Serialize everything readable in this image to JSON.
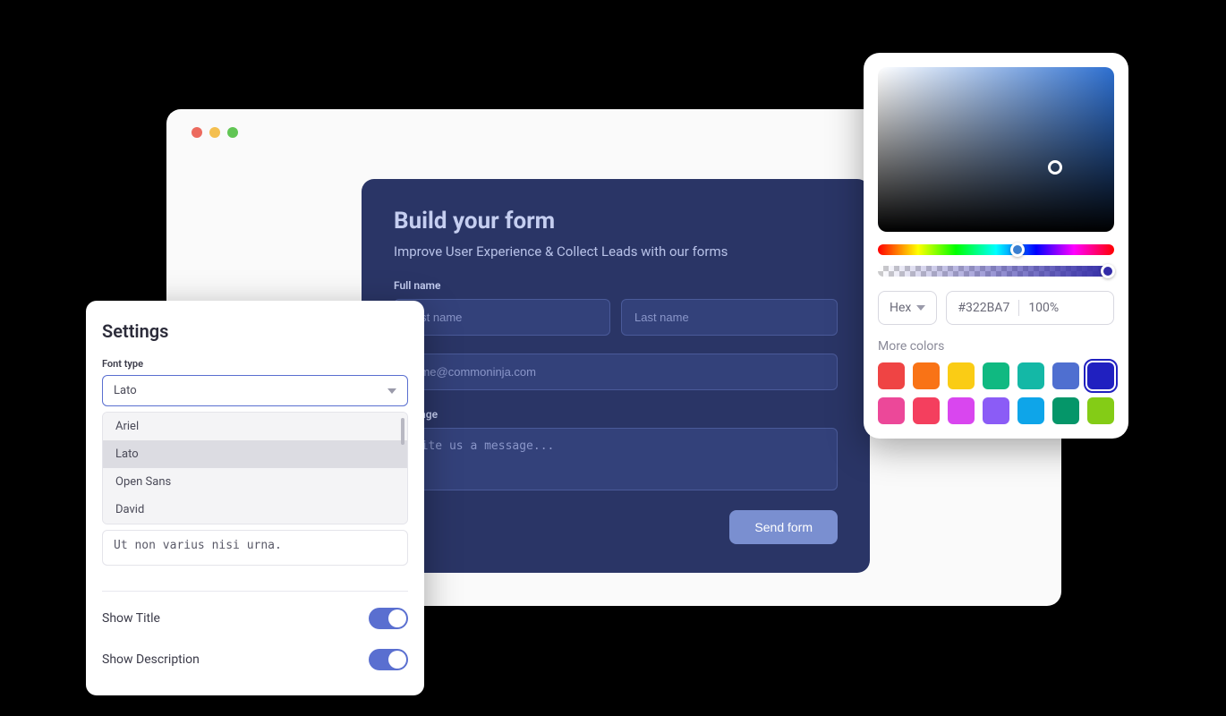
{
  "browser": {
    "controls": [
      "red",
      "yellow",
      "green"
    ]
  },
  "form": {
    "title": "Build your form",
    "subtitle": "Improve User Experience & Collect Leads with our forms",
    "fullname_label": "Full name",
    "firstname_placeholder": "First name",
    "lastname_placeholder": "Last name",
    "email_placeholder": "name@commoninja.com",
    "message_label": "Message",
    "message_placeholder": "Write us a message...",
    "submit_label": "Send form"
  },
  "settings": {
    "title": "Settings",
    "font_label": "Font type",
    "font_selected": "Lato",
    "font_options": [
      "Ariel",
      "Lato",
      "Open Sans",
      "David"
    ],
    "sample_text": "Ut non varius nisi urna.",
    "show_title_label": "Show Title",
    "show_title_on": true,
    "show_desc_label": "Show Description",
    "show_desc_on": true
  },
  "colorpicker": {
    "format_label": "Hex",
    "hex_value": "#322BA7",
    "alpha_value": "100%",
    "more_label": "More colors",
    "swatches_row1": [
      "#ef4444",
      "#f97316",
      "#facc15",
      "#10b981",
      "#14b8a6",
      "#4f6fd0",
      "#2020c0"
    ],
    "swatches_row2": [
      "#ec4899",
      "#f43f5e",
      "#d946ef",
      "#8b5cf6",
      "#0ea5e9",
      "#059669",
      "#84cc16"
    ],
    "selected_swatch": "#2020c0"
  }
}
